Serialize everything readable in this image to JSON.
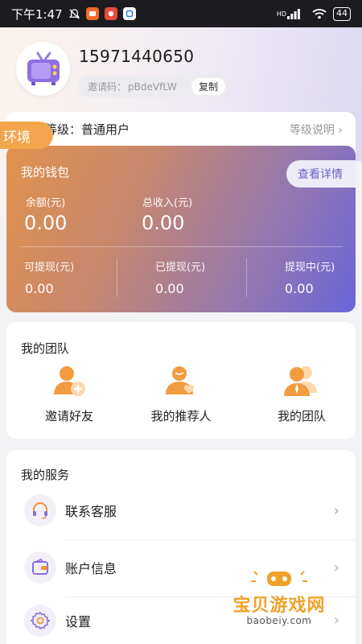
{
  "status_bar": {
    "time": "下午1:47",
    "network": "HD",
    "battery": "44"
  },
  "profile": {
    "phone": "15971440650",
    "invite_label": "邀请码：",
    "invite_code": "pBdeVfLW",
    "copy_label": "复制"
  },
  "env_tag": "环境",
  "level": {
    "label": "等级：",
    "value": "普通用户",
    "link": "等级说明 ›"
  },
  "wallet": {
    "title": "我的钱包",
    "detail_button": "查看详情",
    "balance_label": "余额(元)",
    "balance_value": "0.00",
    "total_income_label": "总收入(元)",
    "total_income_value": "0.00",
    "withdrawable_label": "可提现(元)",
    "withdrawable_value": "0.00",
    "withdrawn_label": "已提现(元)",
    "withdrawn_value": "0.00",
    "withdrawing_label": "提现中(元)",
    "withdrawing_value": "0.00"
  },
  "team": {
    "title": "我的团队",
    "items": [
      {
        "label": "邀请好友",
        "icon": "invite-friend-icon"
      },
      {
        "label": "我的推荐人",
        "icon": "referrer-icon"
      },
      {
        "label": "我的团队",
        "icon": "team-icon"
      }
    ]
  },
  "services": {
    "title": "我的服务",
    "items": [
      {
        "label": "联系客服",
        "icon": "headset-icon"
      },
      {
        "label": "账户信息",
        "icon": "wallet-icon"
      },
      {
        "label": "设置",
        "icon": "gear-icon"
      }
    ]
  },
  "watermark": {
    "text": "宝贝游戏网",
    "sub": "baobeiy.com"
  },
  "colors": {
    "accent_orange": "#f2a54c",
    "accent_purple": "#6d62c9"
  }
}
